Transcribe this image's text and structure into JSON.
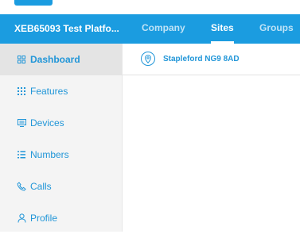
{
  "header": {
    "app_title": "XEB65093 Test Platfo...",
    "tabs": [
      {
        "label": "Company",
        "active": false
      },
      {
        "label": "Sites",
        "active": true
      },
      {
        "label": "Groups",
        "active": false
      }
    ]
  },
  "sidebar": {
    "items": [
      {
        "label": "Dashboard",
        "icon": "dashboard-grid-icon",
        "active": true
      },
      {
        "label": "Features",
        "icon": "features-grid-icon",
        "active": false
      },
      {
        "label": "Devices",
        "icon": "devices-icon",
        "active": false
      },
      {
        "label": "Numbers",
        "icon": "numbers-list-icon",
        "active": false
      },
      {
        "label": "Calls",
        "icon": "phone-icon",
        "active": false
      },
      {
        "label": "Profile",
        "icon": "person-icon",
        "active": false
      }
    ]
  },
  "site": {
    "name": "Stapleford NG9 8AD",
    "icon": "location-pin-icon"
  },
  "colors": {
    "brand": "#1b9ce0",
    "accent_text": "#2196d8",
    "sidebar_bg": "#f4f4f4"
  }
}
